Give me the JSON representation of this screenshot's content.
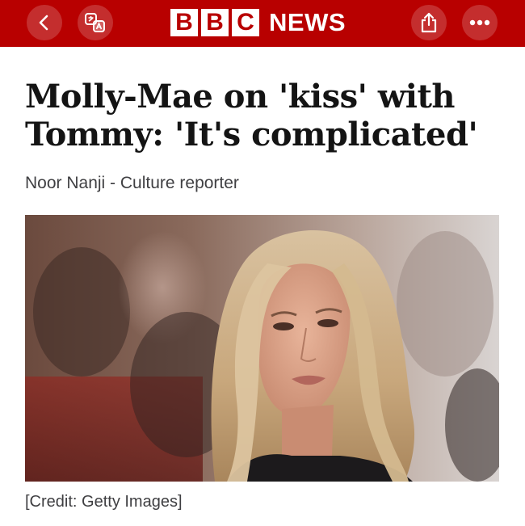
{
  "header": {
    "logo_letters": [
      "B",
      "B",
      "C"
    ],
    "logo_word": "NEWS",
    "brand_color": "#b80000",
    "icons": {
      "back": "chevron-left-icon",
      "translate": "translate-icon",
      "share": "share-icon",
      "more": "more-icon"
    }
  },
  "article": {
    "headline": "Molly-Mae on 'kiss' with Tommy: 'It's complicated'",
    "byline": "Noor Nanji - Culture reporter",
    "image_credit": "[Credit: Getty Images]"
  }
}
